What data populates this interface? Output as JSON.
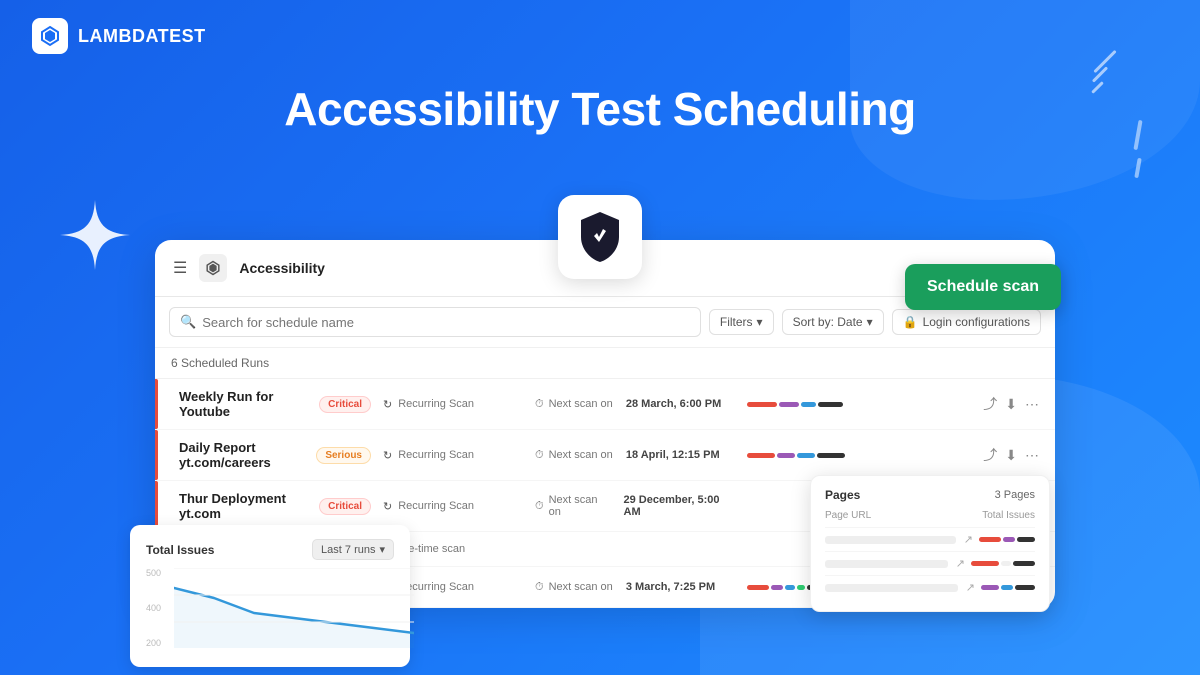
{
  "app": {
    "name": "LAMBDATEST",
    "hero_title": "Accessibility Test Scheduling"
  },
  "panel": {
    "title": "Accessibility",
    "scheduled_count": "6 Scheduled Runs",
    "search_placeholder": "Search for schedule name",
    "filters_label": "Filters",
    "sort_label": "Sort by: Date",
    "login_label": "Login configurations",
    "schedule_btn": "Schedule scan"
  },
  "rows": [
    {
      "name": "Weekly Run for Youtube",
      "badge": "Critical",
      "badge_type": "critical",
      "scan_type": "Recurring Scan",
      "next_label": "Next scan on",
      "next_date": "28 March, 6:00 PM",
      "bars": [
        {
          "color": "#e74c3c",
          "width": 30
        },
        {
          "color": "#9b59b6",
          "width": 20
        },
        {
          "color": "#3498db",
          "width": 15
        },
        {
          "color": "#333",
          "width": 25
        }
      ]
    },
    {
      "name": "Daily Report yt.com/careers",
      "badge": "Serious",
      "badge_type": "serious",
      "scan_type": "Recurring Scan",
      "next_label": "Next scan on",
      "next_date": "18 April, 12:15 PM",
      "bars": [
        {
          "color": "#e74c3c",
          "width": 28
        },
        {
          "color": "#9b59b6",
          "width": 18
        },
        {
          "color": "#3498db",
          "width": 18
        },
        {
          "color": "#333",
          "width": 28
        }
      ]
    },
    {
      "name": "Thur Deployment yt.com",
      "badge": "Critical",
      "badge_type": "critical",
      "scan_type": "Recurring Scan",
      "next_label": "Next scan on",
      "next_date": "29 December, 5:00 AM",
      "bars": []
    },
    {
      "name": "",
      "badge": "",
      "badge_type": "",
      "scan_type": "One-time scan",
      "next_label": "",
      "next_date": "",
      "bars": []
    },
    {
      "name": "",
      "badge": "",
      "badge_type": "",
      "scan_type": "Recurring Scan",
      "next_label": "Next scan on",
      "next_date": "3 March, 7:25 PM",
      "bars": [
        {
          "color": "#e74c3c",
          "width": 22
        },
        {
          "color": "#9b59b6",
          "width": 15
        },
        {
          "color": "#3498db",
          "width": 12
        },
        {
          "color": "#2ecc71",
          "width": 10
        },
        {
          "color": "#333",
          "width": 20
        }
      ]
    }
  ],
  "pages_popup": {
    "title": "Pages",
    "count": "3 Pages",
    "col_url": "Page URL",
    "col_issues": "Total Issues"
  },
  "chart": {
    "title": "Total Issues",
    "filter": "Last 7 runs",
    "y_labels": [
      "500",
      "400",
      "200"
    ]
  },
  "icons": {
    "hamburger": "☰",
    "search": "🔍",
    "shield": "🛡",
    "recurring": "↻",
    "clock": "⏱",
    "share": "⤴",
    "download": "⬇",
    "more": "⋯",
    "filter": "▼",
    "lock": "🔒",
    "external": "↗",
    "chevron_down": "▾"
  }
}
